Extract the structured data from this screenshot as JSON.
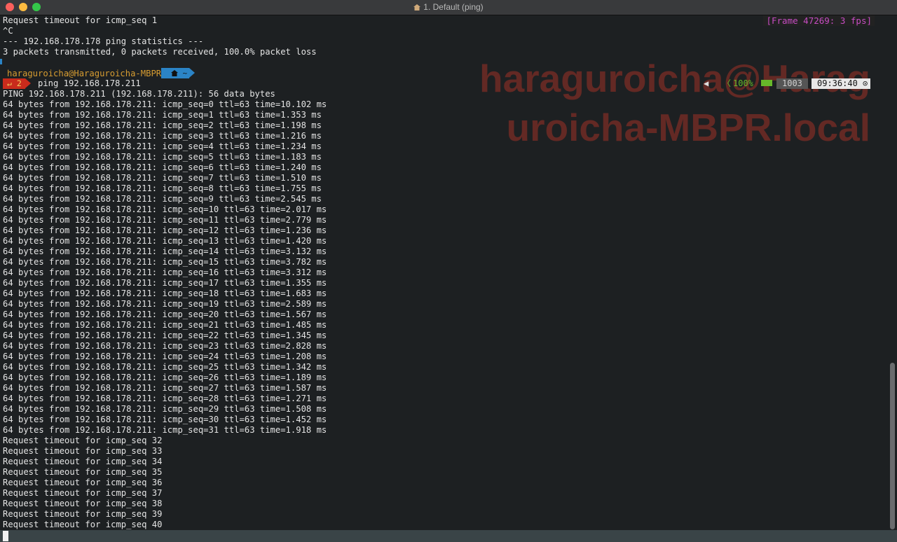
{
  "window": {
    "title": "1. Default (ping)"
  },
  "overlay": {
    "frame_counter": "[Frame 47269: 3 fps]",
    "watermark_lines": [
      "haraguroicha@Harag",
      "uroicha-MBPR.local"
    ]
  },
  "pre_prompt_lines": [
    "Request timeout for icmp_seq 1",
    "^C",
    "--- 192.168.178.178 ping statistics ---",
    "3 packets transmitted, 0 packets received, 100.0% packet loss"
  ],
  "prompt": {
    "user_host": "haraguroicha@Haraguroicha-MBPR",
    "dir": "~",
    "status_symbol": "↵",
    "status_code": "2",
    "command": "ping 192.168.178.211"
  },
  "right_status": {
    "battery": "100%",
    "load": "1003",
    "time": "09:36:40"
  },
  "output_lines": [
    "PING 192.168.178.211 (192.168.178.211): 56 data bytes",
    "64 bytes from 192.168.178.211: icmp_seq=0 ttl=63 time=10.102 ms",
    "64 bytes from 192.168.178.211: icmp_seq=1 ttl=63 time=1.353 ms",
    "64 bytes from 192.168.178.211: icmp_seq=2 ttl=63 time=1.198 ms",
    "64 bytes from 192.168.178.211: icmp_seq=3 ttl=63 time=1.216 ms",
    "64 bytes from 192.168.178.211: icmp_seq=4 ttl=63 time=1.234 ms",
    "64 bytes from 192.168.178.211: icmp_seq=5 ttl=63 time=1.183 ms",
    "64 bytes from 192.168.178.211: icmp_seq=6 ttl=63 time=1.240 ms",
    "64 bytes from 192.168.178.211: icmp_seq=7 ttl=63 time=1.510 ms",
    "64 bytes from 192.168.178.211: icmp_seq=8 ttl=63 time=1.755 ms",
    "64 bytes from 192.168.178.211: icmp_seq=9 ttl=63 time=2.545 ms",
    "64 bytes from 192.168.178.211: icmp_seq=10 ttl=63 time=2.017 ms",
    "64 bytes from 192.168.178.211: icmp_seq=11 ttl=63 time=2.779 ms",
    "64 bytes from 192.168.178.211: icmp_seq=12 ttl=63 time=1.236 ms",
    "64 bytes from 192.168.178.211: icmp_seq=13 ttl=63 time=1.420 ms",
    "64 bytes from 192.168.178.211: icmp_seq=14 ttl=63 time=3.132 ms",
    "64 bytes from 192.168.178.211: icmp_seq=15 ttl=63 time=3.782 ms",
    "64 bytes from 192.168.178.211: icmp_seq=16 ttl=63 time=3.312 ms",
    "64 bytes from 192.168.178.211: icmp_seq=17 ttl=63 time=1.355 ms",
    "64 bytes from 192.168.178.211: icmp_seq=18 ttl=63 time=1.683 ms",
    "64 bytes from 192.168.178.211: icmp_seq=19 ttl=63 time=2.589 ms",
    "64 bytes from 192.168.178.211: icmp_seq=20 ttl=63 time=1.567 ms",
    "64 bytes from 192.168.178.211: icmp_seq=21 ttl=63 time=1.485 ms",
    "64 bytes from 192.168.178.211: icmp_seq=22 ttl=63 time=1.345 ms",
    "64 bytes from 192.168.178.211: icmp_seq=23 ttl=63 time=2.828 ms",
    "64 bytes from 192.168.178.211: icmp_seq=24 ttl=63 time=1.208 ms",
    "64 bytes from 192.168.178.211: icmp_seq=25 ttl=63 time=1.342 ms",
    "64 bytes from 192.168.178.211: icmp_seq=26 ttl=63 time=1.189 ms",
    "64 bytes from 192.168.178.211: icmp_seq=27 ttl=63 time=1.587 ms",
    "64 bytes from 192.168.178.211: icmp_seq=28 ttl=63 time=1.271 ms",
    "64 bytes from 192.168.178.211: icmp_seq=29 ttl=63 time=1.508 ms",
    "64 bytes from 192.168.178.211: icmp_seq=30 ttl=63 time=1.452 ms",
    "64 bytes from 192.168.178.211: icmp_seq=31 ttl=63 time=1.918 ms",
    "Request timeout for icmp_seq 32",
    "Request timeout for icmp_seq 33",
    "Request timeout for icmp_seq 34",
    "Request timeout for icmp_seq 35",
    "Request timeout for icmp_seq 36",
    "Request timeout for icmp_seq 37",
    "Request timeout for icmp_seq 38",
    "Request timeout for icmp_seq 39",
    "Request timeout for icmp_seq 40"
  ],
  "icons": [
    "close-button",
    "minimize-button",
    "zoom-button",
    "house-icon",
    "apple-icon",
    "battery-icon",
    "clock-icon"
  ]
}
